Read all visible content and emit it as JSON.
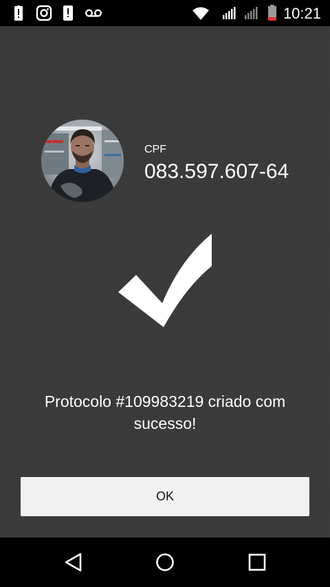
{
  "status_bar": {
    "time": "10:21",
    "icons": [
      "alert-icon",
      "instagram-icon",
      "notification-icon",
      "voicemail-icon",
      "wifi-icon",
      "signal-icon",
      "signal-weak-icon",
      "battery-low-icon"
    ]
  },
  "profile": {
    "cpf_label": "CPF",
    "cpf_value": "083.597.607-64"
  },
  "success": {
    "icon": "checkmark-icon",
    "message": "Protocolo #109983219 criado com sucesso!"
  },
  "actions": {
    "ok_label": "OK"
  },
  "nav_bar": {
    "icons": [
      "back-icon",
      "home-icon",
      "recents-icon"
    ]
  },
  "colors": {
    "background": "#3a3a3a",
    "button": "#f1f1f1",
    "text": "#ffffff"
  }
}
